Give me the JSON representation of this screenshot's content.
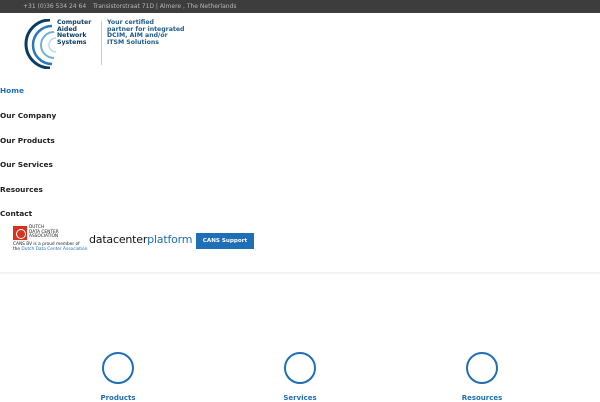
{
  "topbar": {
    "phone": "+31 (0)36 534 24 64",
    "address": "Transistorstraat 71D | Almere , The Netherlands"
  },
  "logo": {
    "name_lines": [
      "Computer",
      "Aided",
      "Network",
      "Systems"
    ],
    "tagline_lines": [
      "Your certified",
      "partner for integrated",
      "DCIM, AIM and/or",
      "ITSM Solutions"
    ],
    "brand_color": "#0a3d66"
  },
  "nav": {
    "items": [
      {
        "label": "Home",
        "active": true
      },
      {
        "label": "Our Company",
        "active": false
      },
      {
        "label": "Our Products",
        "active": false
      },
      {
        "label": "Our Services",
        "active": false
      },
      {
        "label": "Resources",
        "active": false
      },
      {
        "label": "Contact",
        "active": false
      }
    ]
  },
  "partners": {
    "ddca_lines": [
      "DUTCH",
      "DATA CENTER",
      "ASSOCIATION"
    ],
    "ddca_member_text": "CANS BV is a proud member of",
    "ddca_member_prefix": "the ",
    "ddca_link_text": "Dutch Data Center Association",
    "dcp_part1": "datacenter",
    "dcp_part2": "platform"
  },
  "support_button": {
    "label": "CANS Support"
  },
  "features": [
    {
      "label": "Products"
    },
    {
      "label": "Services"
    },
    {
      "label": "Resources"
    }
  ],
  "colors": {
    "accent": "#1e6fb6",
    "topbar_bg": "#3d3d3d",
    "ddca_red": "#d7321e"
  }
}
